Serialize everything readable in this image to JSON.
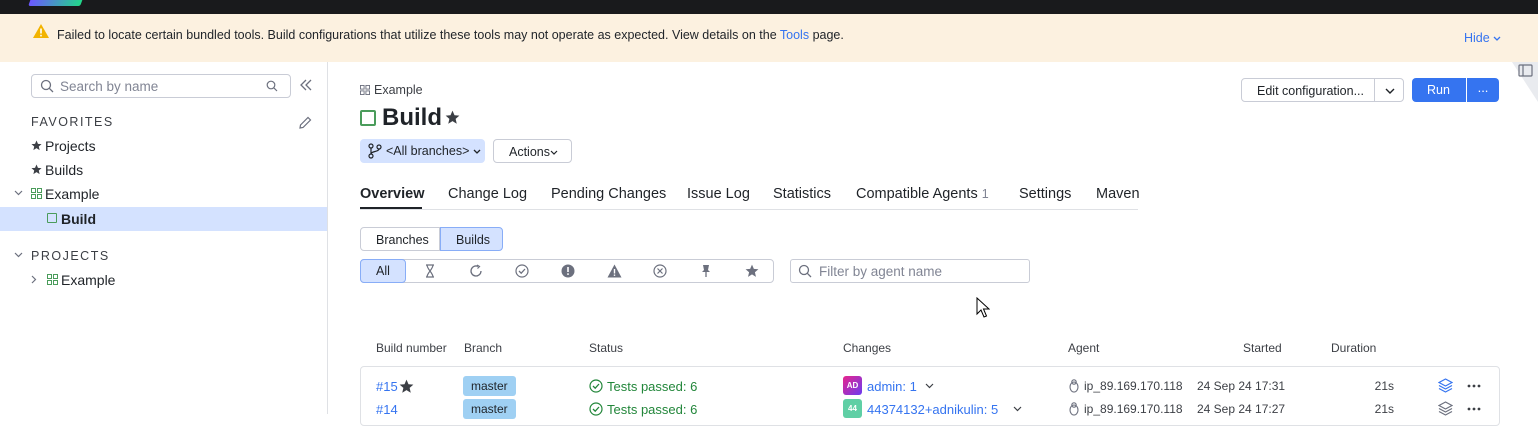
{
  "warning": {
    "text_before": "Failed to locate certain bundled tools. Build configurations that utilize these tools may not operate as expected. View details on the ",
    "link": "Tools",
    "text_after": " page.",
    "hide": "Hide"
  },
  "sidebar": {
    "search_placeholder": "Search by name",
    "favorites_title": "FAVORITES",
    "favorites": [
      {
        "label": "Projects"
      },
      {
        "label": "Builds"
      },
      {
        "label": "Example"
      },
      {
        "label": "Build"
      }
    ],
    "projects_title": "PROJECTS",
    "projects": [
      {
        "label": "Example"
      }
    ]
  },
  "header": {
    "breadcrumb": "Example",
    "title": "Build",
    "branches": "<All branches>",
    "actions": "Actions",
    "edit_config": "Edit configuration...",
    "run": "Run",
    "more": "..."
  },
  "tabs": [
    {
      "label": "Overview"
    },
    {
      "label": "Change Log"
    },
    {
      "label": "Pending Changes"
    },
    {
      "label": "Issue Log"
    },
    {
      "label": "Statistics"
    },
    {
      "label": "Compatible Agents",
      "count": "1"
    },
    {
      "label": "Settings"
    },
    {
      "label": "Maven"
    }
  ],
  "view_toggle": {
    "branches": "Branches",
    "builds": "Builds"
  },
  "filter": {
    "all": "All",
    "agent_placeholder": "Filter by agent name"
  },
  "table": {
    "headers": {
      "build_number": "Build number",
      "branch": "Branch",
      "status": "Status",
      "changes": "Changes",
      "agent": "Agent",
      "started": "Started",
      "duration": "Duration"
    },
    "rows": [
      {
        "number": "#15",
        "branch": "master",
        "status": "Tests passed: 6",
        "avatar": "AD",
        "changes": "admin: 1",
        "agent": "ip_89.169.170.118",
        "started": "24 Sep 24 17:31",
        "duration": "21s"
      },
      {
        "number": "#14",
        "branch": "master",
        "status": "Tests passed: 6",
        "avatar": "44",
        "changes": "44374132+adnikulin: 5",
        "agent": "ip_89.169.170.118",
        "started": "24 Sep 24 17:27",
        "duration": "21s"
      }
    ]
  },
  "colors": {
    "accent": "#3574f0",
    "selection": "#d4e2ff",
    "warning_bg": "#fcf1e0",
    "success": "#22863a"
  }
}
